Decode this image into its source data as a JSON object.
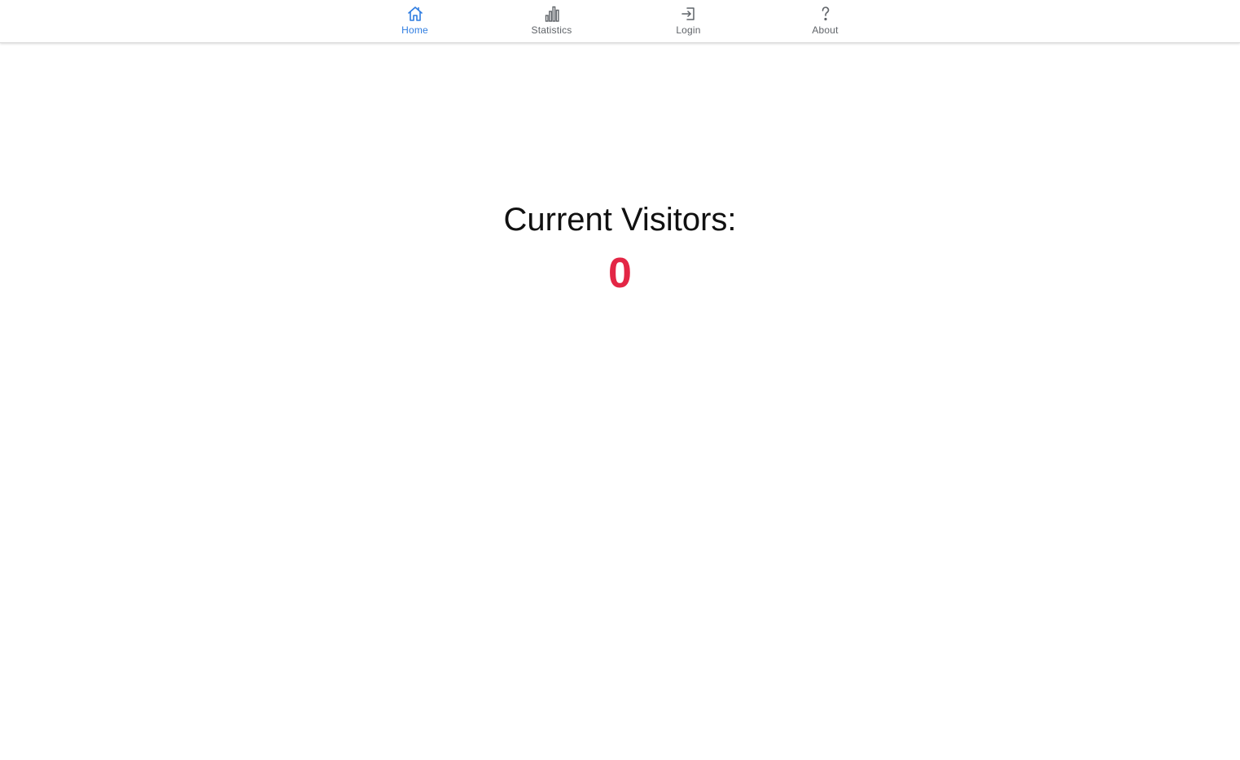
{
  "colors": {
    "active_nav": "#2f7de1",
    "inactive_nav": "#5f6368",
    "counter": "#e32645",
    "title": "#111111"
  },
  "nav": {
    "items": [
      {
        "label": "Home",
        "icon": "home-icon",
        "active": true
      },
      {
        "label": "Statistics",
        "icon": "bar-chart-icon",
        "active": false
      },
      {
        "label": "Login",
        "icon": "login-icon",
        "active": false
      },
      {
        "label": "About",
        "icon": "question-mark-icon",
        "active": false
      }
    ]
  },
  "main": {
    "title": "Current Visitors:",
    "visitor_count": "0"
  }
}
